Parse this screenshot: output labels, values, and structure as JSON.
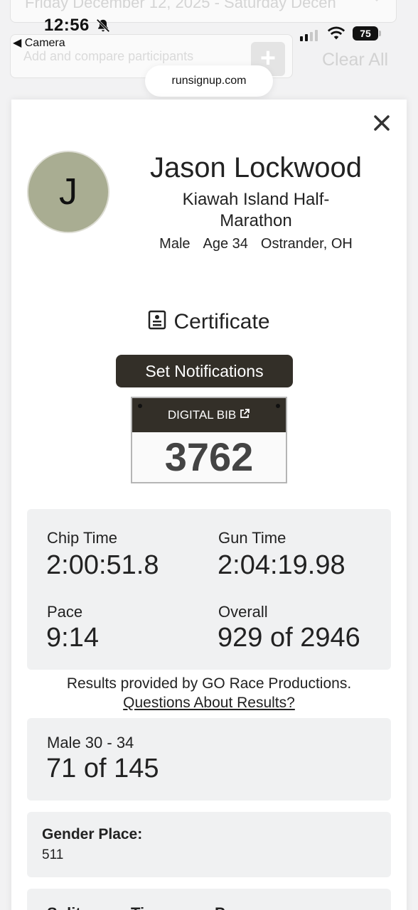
{
  "background": {
    "date_select": "Friday December 12, 2025 - Saturday Decen",
    "compare_placeholder": "Add and compare participants",
    "clear_all": "Clear All"
  },
  "status_bar": {
    "time": "12:56",
    "back_label": "◀ Camera",
    "battery": "75",
    "url": "runsignup.com"
  },
  "participant": {
    "initial": "J",
    "name": "Jason Lockwood",
    "event": "Kiawah Island Half-Marathon",
    "gender": "Male",
    "age": "Age 34",
    "location": "Ostrander, OH"
  },
  "certificate_label": "Certificate",
  "set_notifications_label": "Set Notifications",
  "bib": {
    "label": "DIGITAL BIB",
    "number": "3762"
  },
  "results": {
    "chip_time_label": "Chip Time",
    "chip_time": "2:00:51.8",
    "gun_time_label": "Gun Time",
    "gun_time": "2:04:19.98",
    "pace_label": "Pace",
    "pace": "9:14",
    "overall_label": "Overall",
    "overall": "929 of 2946"
  },
  "provider": {
    "text": "Results provided by GO Race Productions.",
    "link": "Questions About Results?"
  },
  "division": {
    "label": "Male 30 - 34",
    "place": "71 of 145"
  },
  "gender_place": {
    "label": "Gender Place:",
    "value": "511"
  },
  "splits_headers": [
    "Split",
    "Time",
    "Pace"
  ]
}
